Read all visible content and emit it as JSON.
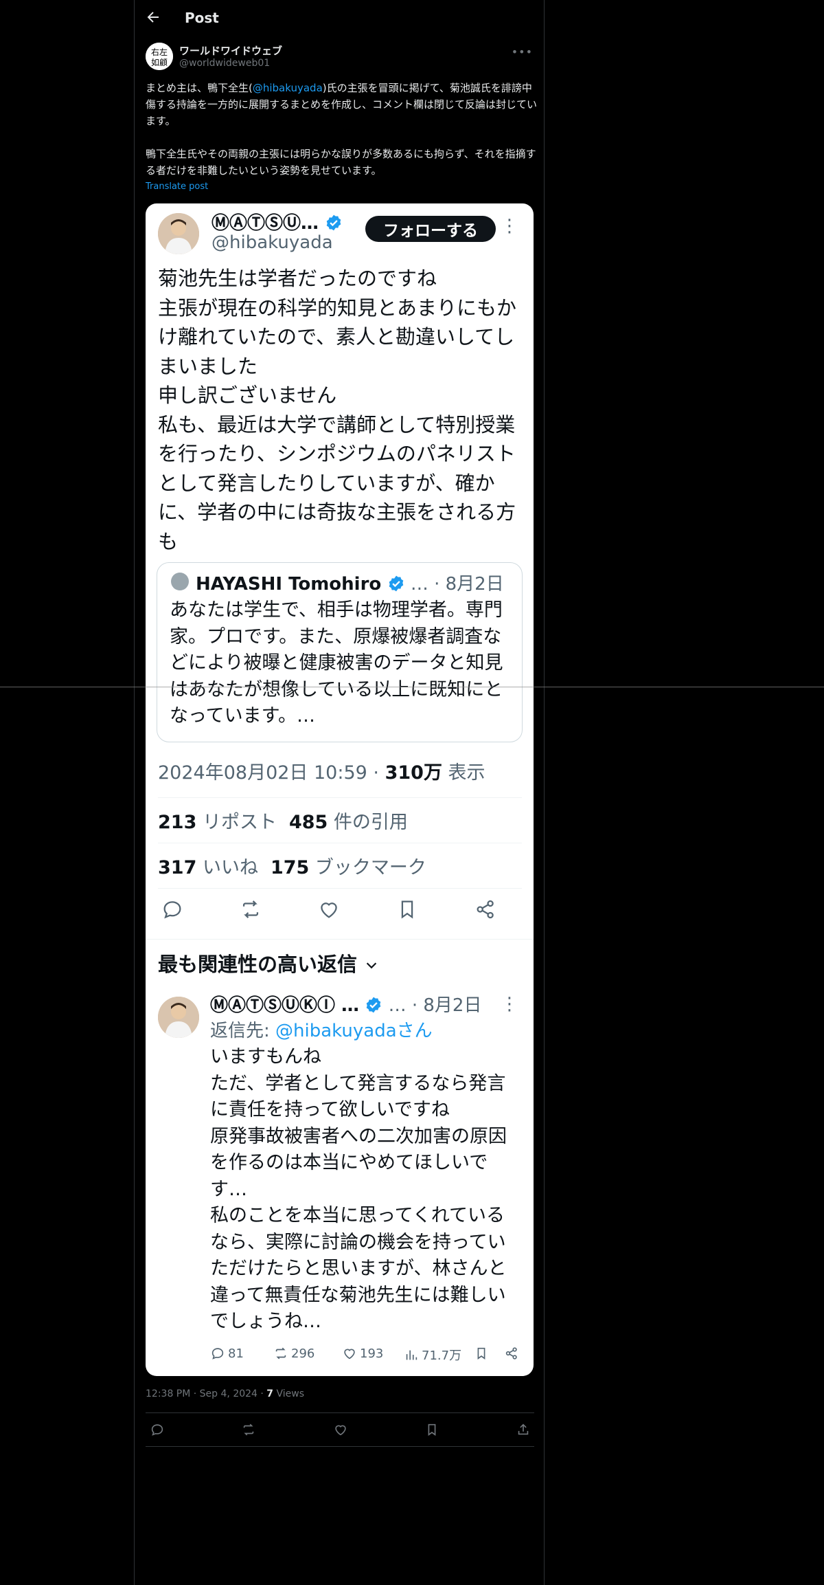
{
  "header": {
    "title": "Post"
  },
  "author": {
    "name": "ワールドワイドウェブ",
    "handle": "@worldwideweb01",
    "avatar_text": "右左 如顧"
  },
  "post": {
    "line1_a": "まとめ主は、鴨下全生(",
    "line1_mention": "@hibakuyada",
    "line1_b": ")氏の主張を冒頭に掲げて、菊池誠氏を誹謗中傷する持論を一方的に展開するまとめを作成し、コメント欄は閉じて反論は封じています。",
    "para2": "鴨下全生氏やその両親の主張には明らかな誤りが多数あるにも拘らず、それを指摘する者だけを非難したいという姿勢を見せています。",
    "translate": "Translate post"
  },
  "embedded": {
    "name": "ⓂⒶⓉⓈⓊ…",
    "handle": "@hibakuyada",
    "follow": "フォローする",
    "text": [
      "菊池先生は学者だったのですね",
      "主張が現在の科学的知見とあまりにもかけ離れていたので、素人と勘違いしてしまいました",
      "申し訳ございません",
      "私も、最近は大学で講師として特別授業を行ったり、シンポジウムのパネリストとして発言したりしていますが、確かに、学者の中には奇抜な主張をされる方も"
    ],
    "quote": {
      "name": "HAYASHI Tomohiro",
      "meta": "… · 8月2日",
      "text": "あなたは学生で、相手は物理学者。専門家。プロです。また、原爆被爆者調査などにより被曝と健康被害のデータと知見はあなたが想像している以上に既知にとなっています。…"
    },
    "timestamp": "2024年08月02日 10:59 · ",
    "views_count": "310万",
    "views_label": " 表示",
    "reposts_count": "213",
    "reposts_label": " リポスト",
    "quotes_count": "485",
    "quotes_label": " 件の引用",
    "likes_count": "317",
    "likes_label": " いいね",
    "bookmarks_count": "175",
    "bookmarks_label": " ブックマーク",
    "relevant_label": "最も関連性の高い返信",
    "reply": {
      "name": "ⓂⒶⓉⓈⓊⓀⒾ …",
      "meta": " … · 8月2日",
      "reply_to_prefix": "返信先: ",
      "reply_to_handle": "@hibakuyadaさん",
      "text": [
        "いますもんね",
        "ただ、学者として発言するなら発言に責任を持って欲しいですね",
        "原発事故被害者への二次加害の原因を作るのは本当にやめてほしいです…",
        "私のことを本当に思ってくれているなら、実際に討論の機会を持っていただけたらと思いますが、林さんと違って無責任な菊池先生には難しいでしょうね…"
      ],
      "replies": "81",
      "reposts": "296",
      "likes": "193",
      "views": "71.7万"
    }
  },
  "meta": {
    "time": "12:38 PM · Sep 4, 2024 · ",
    "views_count": "7",
    "views_label": " Views"
  },
  "colors": {
    "accent": "#1d9bf0",
    "background": "#000000",
    "muted": "#71767b",
    "card": "#ffffff"
  }
}
